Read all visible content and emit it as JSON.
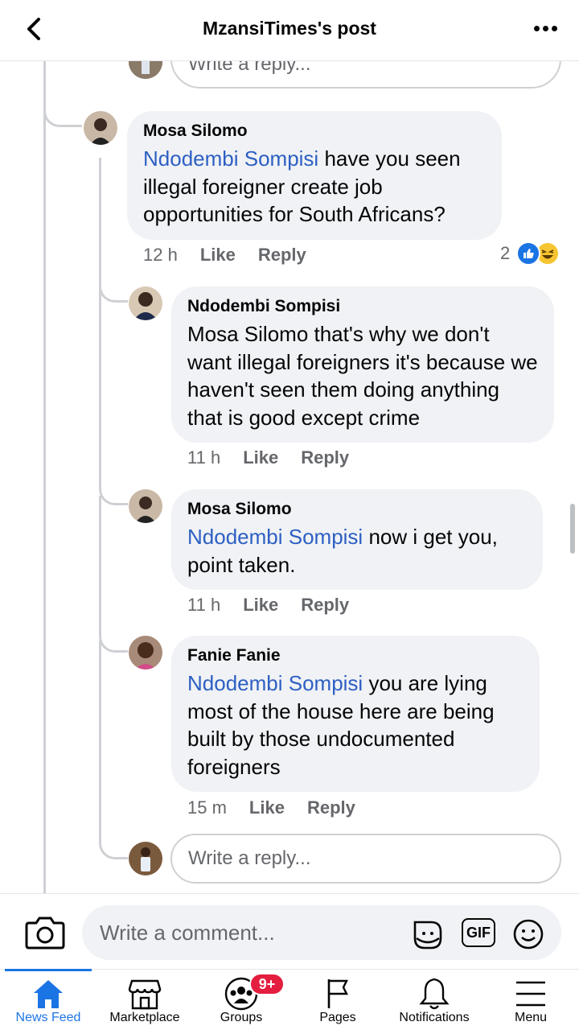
{
  "header": {
    "title": "MzansiTimes's post"
  },
  "thread": {
    "top_reply_placeholder": "Write a reply...",
    "comments": [
      {
        "author": "Mosa Silomo",
        "mention": "Ndodembi Sompisi",
        "text": " have you seen illegal foreigner create job opportunities for South Africans?",
        "time": "12 h",
        "like": "Like",
        "reply": "Reply",
        "reaction_count": "2"
      },
      {
        "author": "Ndodembi Sompisi",
        "text": "Mosa Silomo that's why we don't want illegal foreigners it's because we haven't seen them doing anything that is good except crime",
        "time": "11 h",
        "like": "Like",
        "reply": "Reply"
      },
      {
        "author": "Mosa Silomo",
        "mention": "Ndodembi Sompisi",
        "text": " now i get you, point taken.",
        "time": "11 h",
        "like": "Like",
        "reply": "Reply"
      },
      {
        "author": "Fanie Fanie",
        "mention": "Ndodembi Sompisi",
        "text": " you are lying most of the house here are being built by those undocumented foreigners",
        "time": "15 m",
        "like": "Like",
        "reply": "Reply"
      }
    ],
    "reply_placeholder": "Write a reply..."
  },
  "composer": {
    "placeholder": "Write a comment...",
    "gif_label": "GIF"
  },
  "tabs": [
    {
      "label": "News Feed",
      "icon": "home-icon",
      "active": true
    },
    {
      "label": "Marketplace",
      "icon": "marketplace-icon"
    },
    {
      "label": "Groups",
      "icon": "groups-icon",
      "badge": "9+"
    },
    {
      "label": "Pages",
      "icon": "flag-icon"
    },
    {
      "label": "Notifications",
      "icon": "bell-icon"
    },
    {
      "label": "Menu",
      "icon": "menu-icon"
    }
  ],
  "colors": {
    "accent": "#1b74e4",
    "mention": "#2d5fc3",
    "bubble": "#f0f2f5",
    "badge": "#e41e3f"
  }
}
